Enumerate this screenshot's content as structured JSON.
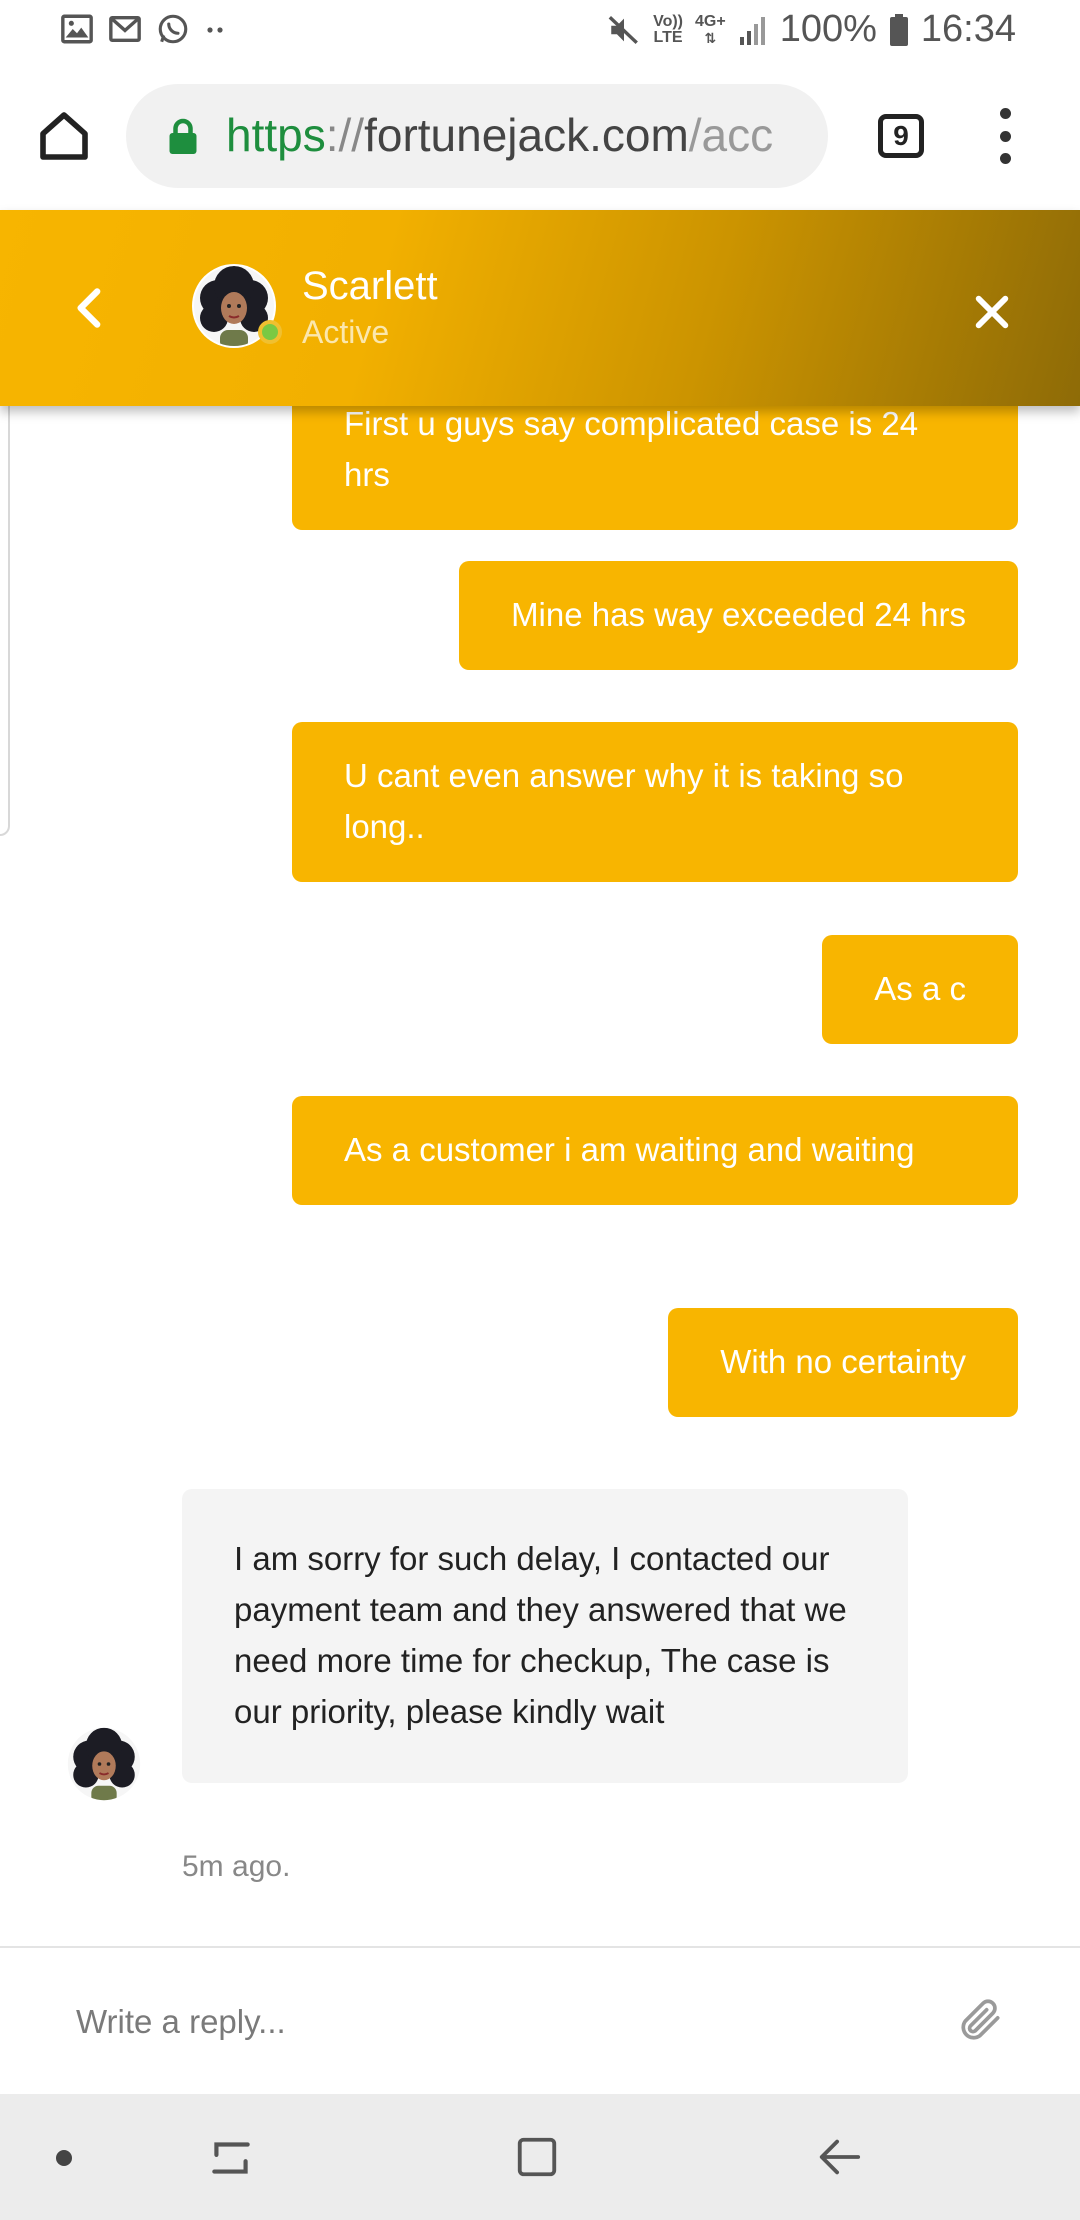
{
  "status_bar": {
    "network_top": "Vo))",
    "network_bottom": "LTE",
    "data_type": "4G+",
    "battery": "100%",
    "time": "16:34"
  },
  "browser": {
    "url_scheme": "https",
    "url_sep": "://",
    "url_host": "fortunejack.com",
    "url_path": "/acc",
    "tab_count": "9",
    "lock_color": "#1e8e3e"
  },
  "chat_header": {
    "agent_name": "Scarlett",
    "agent_status": "Active",
    "gradient_start": "#f7b500",
    "gradient_end": "#8e6b07"
  },
  "messages": [
    {
      "from": "user",
      "text": "First u guys say complicated case is 24 hrs"
    },
    {
      "from": "user",
      "text": "Mine has way exceeded 24 hrs"
    },
    {
      "from": "user",
      "text": "U cant even answer why it is taking so long.."
    },
    {
      "from": "user",
      "text": "As a c"
    },
    {
      "from": "user",
      "text": "As a customer i am waiting and waiting"
    },
    {
      "from": "user",
      "text": "With no certainty"
    },
    {
      "from": "agent",
      "text": "I am sorry for such delay, I contacted our payment team and they answered that we need more time for checkup, The case is our priority, please kindly wait",
      "time": "5m ago."
    }
  ],
  "reply": {
    "placeholder": "Write a reply..."
  },
  "colors": {
    "user_bubble": "#f8b500",
    "agent_bubble": "#f4f4f4",
    "online": "#7ac943"
  }
}
